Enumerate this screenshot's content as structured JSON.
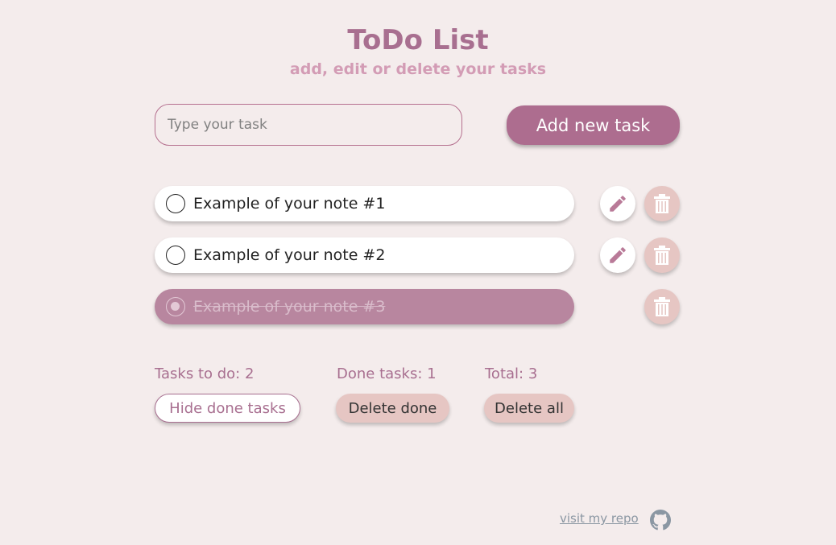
{
  "header": {
    "title": "ToDo List",
    "subtitle": "add, edit or delete your tasks"
  },
  "new_task": {
    "placeholder": "Type your task",
    "value": "",
    "add_label": "Add new task"
  },
  "tasks": [
    {
      "text": "Example of your note #1",
      "done": false,
      "edit_icon": "pencil-icon",
      "delete_icon": "trash-icon"
    },
    {
      "text": "Example of your note #2",
      "done": false,
      "edit_icon": "pencil-icon",
      "delete_icon": "trash-icon"
    },
    {
      "text": "Example of your note #3",
      "done": true,
      "delete_icon": "trash-icon"
    }
  ],
  "stats": {
    "todo": "Tasks to do: 2",
    "done": "Done tasks: 1",
    "total": "Total: 3"
  },
  "controls": {
    "hide_done": "Hide done tasks",
    "delete_done": "Delete done",
    "delete_all": "Delete all"
  },
  "footer": {
    "repo_link": "visit my repo",
    "repo_icon": "github-icon"
  },
  "colors": {
    "background": "#f4ecec",
    "accent": "#ad6d8f",
    "done_task": "#b8869f",
    "delete_button": "#e6c6c3"
  }
}
